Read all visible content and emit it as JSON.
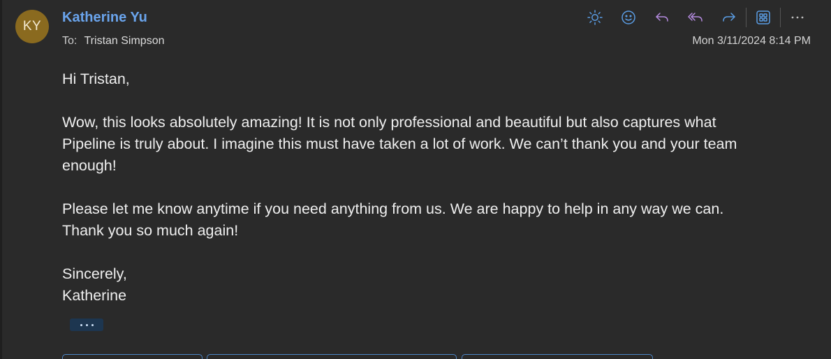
{
  "email": {
    "avatar_initials": "KY",
    "sender_name": "Katherine Yu",
    "to_label": "To:",
    "recipient": "Tristan Simpson",
    "date": "Mon 3/11/2024 8:14 PM",
    "body": {
      "greeting": "Hi Tristan,",
      "paragraph1_line1": "Wow, this looks absolutely amazing! It is not only professional and beautiful but also captures what",
      "paragraph1_line2": "Pipeline is truly about. I imagine this must have taken a lot of work. We can’t thank you and your team",
      "paragraph1_line3": "enough!",
      "paragraph2_line1": "Please let me know anytime if you need anything from us. We are happy to help in any way we can.",
      "paragraph2_line2": "Thank you so much again!",
      "closing": "Sincerely,",
      "signature": "Katherine"
    }
  },
  "toolbar": {
    "icons": [
      "sun-icon",
      "smiley-icon",
      "reply-icon",
      "reply-all-icon",
      "forward-icon",
      "apps-icon",
      "more-icon"
    ]
  },
  "colors": {
    "background": "#2a2a2a",
    "sender": "#6aa4ec",
    "avatar": "#8a6a1f",
    "icon_blue": "#5b9ee6",
    "icon_purple": "#b58be0",
    "accent_border": "#4d86c6"
  }
}
